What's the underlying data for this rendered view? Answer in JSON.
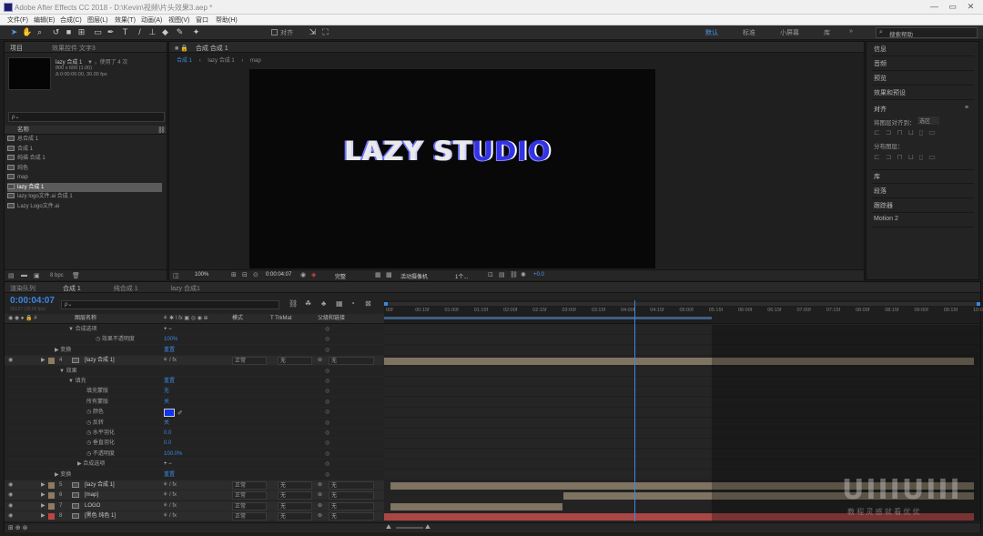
{
  "window": {
    "title": "Adobe After Effects CC 2018 - D:\\Kevin\\视频\\片头效果3.aep *",
    "buttons": [
      "—",
      "▭",
      "✕"
    ]
  },
  "menus": [
    "文件(F)",
    "编辑(E)",
    "合成(C)",
    "图层(L)",
    "效果(T)",
    "动画(A)",
    "视图(V)",
    "窗口",
    "帮助(H)"
  ],
  "toolbar": {
    "snap_label": "对齐",
    "workspaces": [
      "默认",
      "标准",
      "小屏幕",
      "库"
    ],
    "search_placeholder": "搜索帮助",
    "more": "»"
  },
  "project": {
    "tabs": [
      "项目",
      "效果控件 文字3"
    ],
    "comp_name": "lazy 合成 1",
    "used": "▼ ，使用了 4 次",
    "size": "800 x 600 (1.00)",
    "duration": "Δ 0:00:06:00, 30.00 fps",
    "search_prefix": "ρ⌄",
    "column_name": "名称",
    "items": [
      "总合成 1",
      "合成 1",
      "纯描 合成 1",
      "纯色",
      "map",
      "lazy 合成 1",
      "lazy logo文件.ai 合成 1",
      "Lazy Logo文件.ai"
    ],
    "selected_index": 5,
    "footer_bpc": "8 bpc"
  },
  "composition": {
    "tab": "合成 合成 1",
    "breadcrumbs": [
      "合成 1",
      "lazy 合成 1",
      "map"
    ],
    "zoom": "100%",
    "timecode": "0:00:04:07",
    "quality": "完整",
    "camera": "活动摄像机",
    "views": "1个...",
    "exposure": "+0.0",
    "logo_text_1": "LAZY ST",
    "logo_text_2": "UDIO"
  },
  "right_panel": {
    "items": [
      "信息",
      "音频",
      "预览",
      "效果和预设"
    ],
    "align": {
      "title": "对齐",
      "align_to": "将图层对齐到：",
      "align_to_value": "选区",
      "distribute": "分布图层："
    },
    "items2": [
      "库",
      "段落",
      "跟踪器",
      "Motion 2"
    ]
  },
  "timeline": {
    "tabs": [
      "渲染队列",
      "合成 1",
      "纯合成 1",
      "lazy 合成1"
    ],
    "timecode": "0:00:04:07",
    "frame_sub": "00127 (30.00 fps)",
    "search_prefix": "ρ⌄",
    "headers": {
      "layer_name": "图层名称",
      "mode": "模式",
      "trkmat": "T TrkMat",
      "parent": "父级和链接"
    },
    "ruler": [
      "00f",
      "00:15f",
      "01:00f",
      "01:15f",
      "02:00f",
      "02:15f",
      "03:00f",
      "03:15f",
      "04:00f",
      "04:15f",
      "05:00f",
      "05:15f",
      "06:00f",
      "06:15f",
      "07:00f",
      "07:15f",
      "08:00f",
      "08:15f",
      "09:00f",
      "09:15f",
      "10:0"
    ],
    "playhead_fraction": 0.42,
    "work_end_fraction": 0.55,
    "rows": [
      {
        "indent": 70,
        "text": "▼ 合成选项",
        "extra": "+ −"
      },
      {
        "indent": 100,
        "text": "◷ 效果不透明度",
        "value": "100%"
      },
      {
        "indent": 55,
        "text": "▶ 变换",
        "value": "重置"
      },
      {
        "num": "4",
        "name": "[lazy 合成 1]",
        "mode": "正常",
        "trk": "无",
        "parent": "无",
        "color": "#8e7b62",
        "layer": true
      },
      {
        "indent": 60,
        "text": "▼ 效果"
      },
      {
        "indent": 70,
        "text": "▼ 填充",
        "value": "重置"
      },
      {
        "indent": 90,
        "text": "填充蒙版",
        "value": "无"
      },
      {
        "indent": 90,
        "text": "所有蒙版",
        "value": "关"
      },
      {
        "indent": 90,
        "text": "◷ 颜色",
        "swatch": "#1133ee"
      },
      {
        "indent": 90,
        "text": "◷ 反转",
        "value": "关"
      },
      {
        "indent": 90,
        "text": "◷ 水平羽化",
        "value": "0.0"
      },
      {
        "indent": 90,
        "text": "◷ 垂直羽化",
        "value": "0.0"
      },
      {
        "indent": 90,
        "text": "◷ 不透明度",
        "value": "100.0%"
      },
      {
        "indent": 80,
        "text": "▶ 合成选项",
        "extra": "+ −"
      },
      {
        "indent": 55,
        "text": "▶ 变换",
        "value": "重置"
      },
      {
        "num": "5",
        "name": "[lazy 合成 1]",
        "mode": "正常",
        "trk": "无",
        "parent": "无",
        "color": "#8e7b62",
        "layer": true
      },
      {
        "num": "6",
        "name": "[map]",
        "mode": "正常",
        "trk": "无",
        "parent": "无",
        "color": "#8e7b62",
        "layer": true
      },
      {
        "num": "7",
        "name": "LOGO",
        "mode": "正常",
        "trk": "无",
        "parent": "无",
        "color": "#8e7b62",
        "layer": true
      },
      {
        "num": "8",
        "name": "[黑色 纯色 1]",
        "mode": "正常",
        "trk": "无",
        "parent": "无",
        "color": "#bf4444",
        "layer": true
      }
    ],
    "footer": "切换开关/模式"
  },
  "watermark": {
    "logo": "UIIIUIII",
    "sub": "教 程 灵 感 就 看 优 优"
  }
}
